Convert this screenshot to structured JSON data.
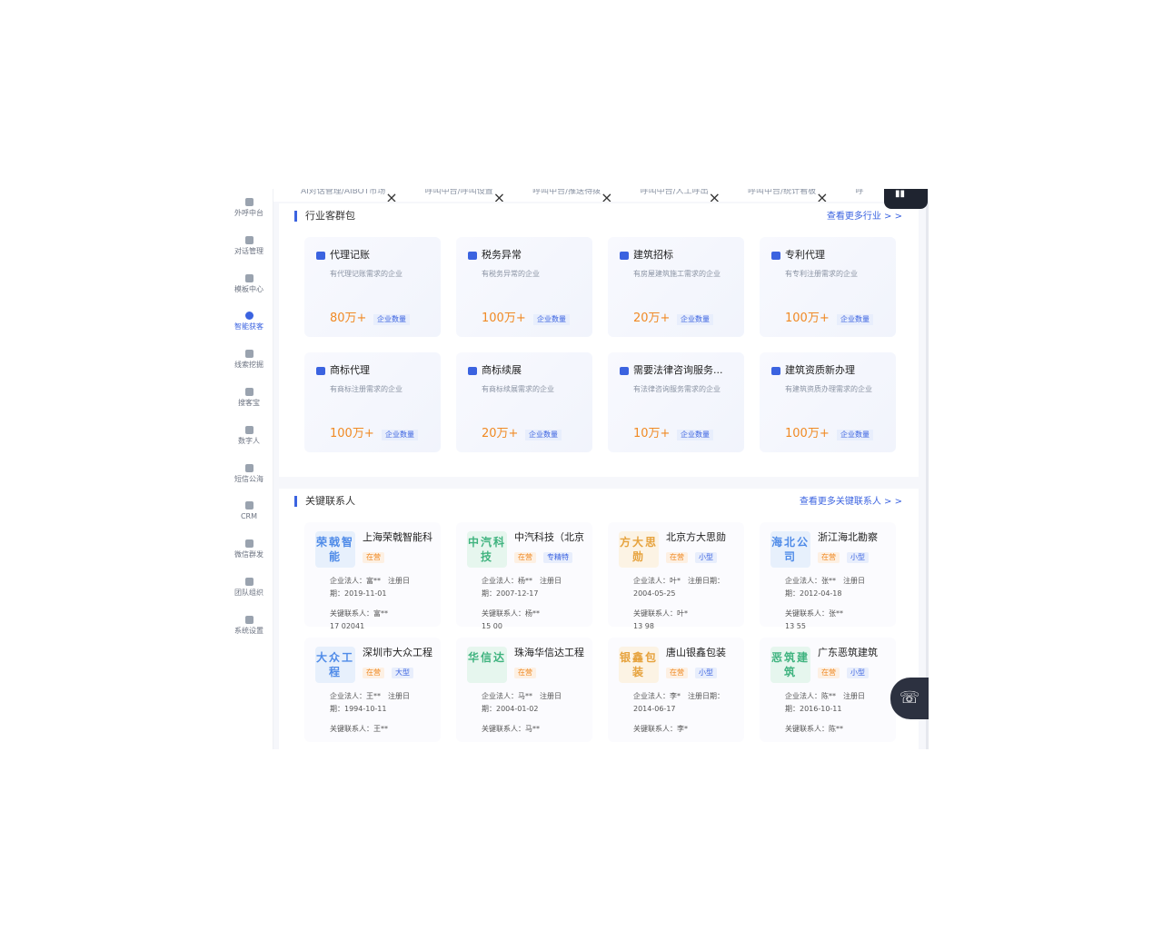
{
  "tabs": [
    "AI对话管理/AIBOT市场",
    "呼叫中台/呼叫设置",
    "呼叫中台/推送待拨",
    "呼叫中台/人工呼出",
    "呼叫中台/统计看板",
    "呼"
  ],
  "sidebar": [
    {
      "label": "外呼中台",
      "icon": "phone-icon"
    },
    {
      "label": "对话管理",
      "icon": "chat-icon"
    },
    {
      "label": "模板中心",
      "icon": "template-icon"
    },
    {
      "label": "智能获客",
      "icon": "search-icon",
      "active": true
    },
    {
      "label": "线索挖掘",
      "icon": "dig-icon"
    },
    {
      "label": "搜客宝",
      "icon": "magnifier-icon"
    },
    {
      "label": "数字人",
      "icon": "person-icon"
    },
    {
      "label": "短信公海",
      "icon": "sms-icon"
    },
    {
      "label": "CRM",
      "icon": "crm-icon"
    },
    {
      "label": "微信群发",
      "icon": "wechat-icon"
    },
    {
      "label": "团队组织",
      "icon": "team-icon"
    },
    {
      "label": "系统设置",
      "icon": "settings-icon"
    }
  ],
  "industry": {
    "title": "行业客群包",
    "more": "查看更多行业 > >",
    "count_badge": "企业数量",
    "cards": [
      {
        "name": "代理记账",
        "desc": "有代理记账需求的企业",
        "count": "80万+"
      },
      {
        "name": "税务异常",
        "desc": "有税务异常的企业",
        "count": "100万+"
      },
      {
        "name": "建筑招标",
        "desc": "有房屋建筑施工需求的企业",
        "count": "20万+"
      },
      {
        "name": "专利代理",
        "desc": "有专利注册需求的企业",
        "count": "100万+"
      },
      {
        "name": "商标代理",
        "desc": "有商标注册需求的企业",
        "count": "100万+"
      },
      {
        "name": "商标续展",
        "desc": "有商标续展需求的企业",
        "count": "20万+"
      },
      {
        "name": "需要法律咨询服务...",
        "desc": "有法律咨询服务需求的企业",
        "count": "10万+"
      },
      {
        "name": "建筑资质新办理",
        "desc": "有建筑资质办理需求的企业",
        "count": "100万+"
      }
    ]
  },
  "contacts": {
    "title": "关键联系人",
    "more": "查看更多关键联系人 > >",
    "status_label": "在营",
    "cards": [
      {
        "logo": "荣戟智能",
        "name": "上海荣戟智能科",
        "size": "",
        "legal": "企业法人：富**",
        "reg_label": "注册日",
        "reg": "期：2019-11-01",
        "key": "关键联系人：富**",
        "phone": "17  02041",
        "color": "#4f8be8",
        "bg": "#e7f0fc"
      },
      {
        "logo": "中汽科技",
        "name": "中汽科技（北京",
        "size": "专精特",
        "legal": "企业法人：杨**",
        "reg_label": "注册日",
        "reg": "期：2007-12-17",
        "key": "关键联系人：杨**",
        "phone": "15  00",
        "color": "#3fb37f",
        "bg": "#e6f6ee"
      },
      {
        "logo": "方大思勋",
        "name": "北京方大思勋",
        "size": "小型",
        "legal": "企业法人：叶*",
        "reg_label": "注册日期：",
        "reg": "2004-05-25",
        "key": "关键联系人：叶*",
        "phone": "13  98",
        "color": "#e6a23c",
        "bg": "#fcf3e4"
      },
      {
        "logo": "海北公司",
        "name": "浙江海北勘察",
        "size": "小型",
        "legal": "企业法人：张**",
        "reg_label": "注册日",
        "reg": "期：2012-04-18",
        "key": "关键联系人：张**",
        "phone": "13  55",
        "color": "#4f8be8",
        "bg": "#e7f0fc"
      },
      {
        "logo": "大众工程",
        "name": "深圳市大众工程",
        "size": "大型",
        "legal": "企业法人：王**",
        "reg_label": "注册日",
        "reg": "期：1994-10-11",
        "key": "关键联系人：王**",
        "phone": "",
        "color": "#4f8be8",
        "bg": "#e7f0fc"
      },
      {
        "logo": "华信达",
        "name": "珠海华信达工程",
        "size": "",
        "legal": "企业法人：马**",
        "reg_label": "注册日",
        "reg": "期：2004-01-02",
        "key": "关键联系人：马**",
        "phone": "",
        "color": "#3fb37f",
        "bg": "#e6f6ee"
      },
      {
        "logo": "银鑫包装",
        "name": "唐山银鑫包装",
        "size": "小型",
        "legal": "企业法人：李*",
        "reg_label": "注册日期：",
        "reg": "2014-06-17",
        "key": "关键联系人：李*",
        "phone": "",
        "color": "#e6a23c",
        "bg": "#fcf3e4"
      },
      {
        "logo": "恶筑建筑",
        "name": "广东恶筑建筑",
        "size": "小型",
        "legal": "企业法人：陈**",
        "reg_label": "注册日",
        "reg": "期：2016-10-11",
        "key": "关键联系人：陈**",
        "phone": "",
        "color": "#3fb37f",
        "bg": "#e6f6ee"
      }
    ]
  }
}
